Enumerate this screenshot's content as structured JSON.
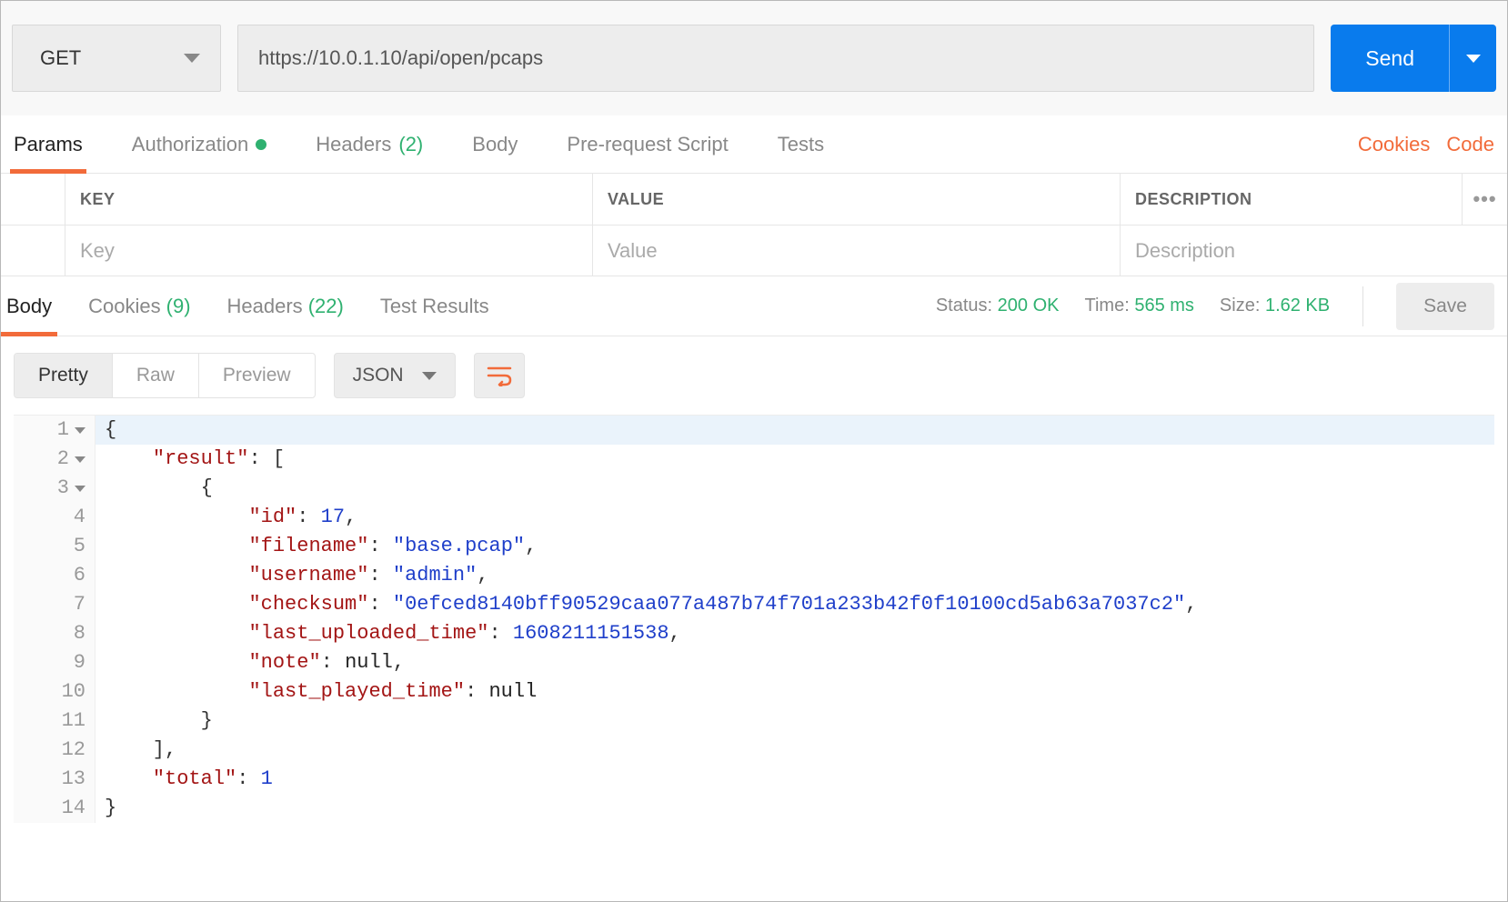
{
  "request": {
    "method": "GET",
    "url": "https://10.0.1.10/api/open/pcaps",
    "send_label": "Send"
  },
  "req_tabs": {
    "params": "Params",
    "authorization": "Authorization",
    "headers": "Headers",
    "headers_count": "(2)",
    "body": "Body",
    "prerequest": "Pre-request Script",
    "tests": "Tests"
  },
  "links": {
    "cookies": "Cookies",
    "code": "Code"
  },
  "params_table": {
    "key_header": "KEY",
    "value_header": "VALUE",
    "desc_header": "DESCRIPTION",
    "key_placeholder": "Key",
    "value_placeholder": "Value",
    "desc_placeholder": "Description"
  },
  "resp_tabs": {
    "body": "Body",
    "cookies": "Cookies",
    "cookies_count": "(9)",
    "headers": "Headers",
    "headers_count": "(22)",
    "test_results": "Test Results"
  },
  "resp_meta": {
    "status_label": "Status:",
    "status_value": "200 OK",
    "time_label": "Time:",
    "time_value": "565 ms",
    "size_label": "Size:",
    "size_value": "1.62 KB",
    "save_label": "Save"
  },
  "body_toolbar": {
    "pretty": "Pretty",
    "raw": "Raw",
    "preview": "Preview",
    "format": "JSON"
  },
  "response_json": {
    "keys": {
      "result": "\"result\"",
      "id": "\"id\"",
      "filename": "\"filename\"",
      "username": "\"username\"",
      "checksum": "\"checksum\"",
      "last_uploaded_time": "\"last_uploaded_time\"",
      "note": "\"note\"",
      "last_played_time": "\"last_played_time\"",
      "total": "\"total\""
    },
    "values": {
      "id": "17",
      "filename": "\"base.pcap\"",
      "username": "\"admin\"",
      "checksum": "\"0efced8140bff90529caa077a487b74f701a233b42f0f10100cd5ab63a7037c2\"",
      "last_uploaded_time": "1608211151538",
      "note": "null",
      "last_played_time": "null",
      "total": "1"
    },
    "line_numbers": [
      "1",
      "2",
      "3",
      "4",
      "5",
      "6",
      "7",
      "8",
      "9",
      "10",
      "11",
      "12",
      "13",
      "14"
    ]
  }
}
